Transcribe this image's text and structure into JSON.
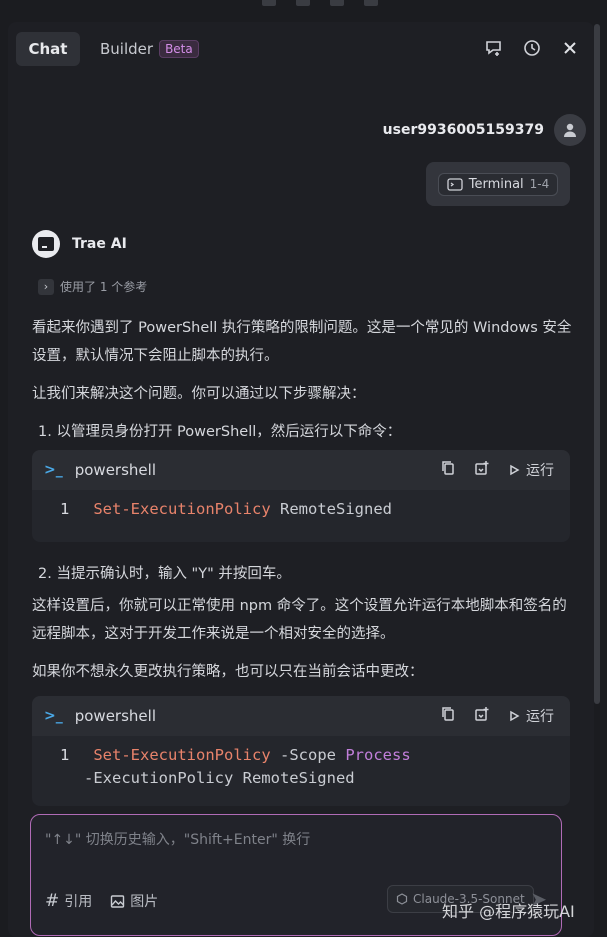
{
  "tabs": {
    "chat": "Chat",
    "builder": "Builder",
    "beta": "Beta"
  },
  "user": {
    "name": "user9936005159379",
    "context_chip": {
      "label": "Terminal",
      "range": "1-4"
    }
  },
  "assistant": {
    "name": "Trae AI",
    "refs": "使用了 1 个参考"
  },
  "messages": {
    "p1": "看起来你遇到了 PowerShell 执行策略的限制问题。这是一个常见的 Windows 安全设置，默认情况下会阻止脚本的执行。",
    "p2": "让我们来解决这个问题。你可以通过以下步骤解决：",
    "step1": "1. 以管理员身份打开 PowerShell，然后运行以下命令：",
    "step2": "2. 当提示确认时，输入 \"Y\" 并按回车。",
    "p3": "这样设置后，你就可以正常使用 npm 命令了。这个设置允许运行本地脚本和签名的远程脚本，这对于开发工作来说是一个相对安全的选择。",
    "p4": "如果你不想永久更改执行策略，也可以只在当前会话中更改："
  },
  "code1": {
    "lang": "powershell",
    "run": "运行",
    "line_no": "1",
    "cmd": "Set-ExecutionPolicy",
    "args": "RemoteSigned"
  },
  "code2": {
    "lang": "powershell",
    "run": "运行",
    "line_no": "1",
    "cmd": "Set-ExecutionPolicy",
    "arg1": "-Scope",
    "arg2": "Process",
    "arg3": "-ExecutionPolicy RemoteSigned"
  },
  "input": {
    "placeholder": "\"↑↓\" 切换历史输入，\"Shift+Enter\" 换行",
    "ref": "引用",
    "image": "图片",
    "model": "Claude-3.5-Sonnet"
  },
  "watermark": "知乎 @程序猿玩AI",
  "icons": [
    "new-chat-icon",
    "history-icon",
    "close-icon",
    "avatar-icon",
    "terminal-icon",
    "powershell-icon",
    "copy-icon",
    "insert-icon",
    "play-icon",
    "hash-icon",
    "image-icon",
    "send-icon"
  ]
}
